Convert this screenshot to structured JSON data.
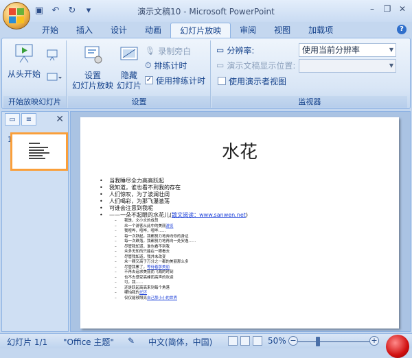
{
  "window": {
    "title": "演示文稿10 - Microsoft PowerPoint",
    "controls": [
      "–",
      "❐",
      "✕"
    ]
  },
  "quick_access": [
    {
      "name": "save-icon",
      "glyph": "💾"
    },
    {
      "name": "undo-icon",
      "glyph": "↶"
    },
    {
      "name": "redo-icon",
      "glyph": "↻"
    },
    {
      "name": "customize-icon",
      "glyph": "▾"
    }
  ],
  "tabs": [
    {
      "id": "home",
      "label": "开始"
    },
    {
      "id": "insert",
      "label": "插入"
    },
    {
      "id": "design",
      "label": "设计"
    },
    {
      "id": "animations",
      "label": "动画"
    },
    {
      "id": "slideshow",
      "label": "幻灯片放映",
      "active": true
    },
    {
      "id": "review",
      "label": "审阅"
    },
    {
      "id": "view",
      "label": "视图"
    },
    {
      "id": "addins",
      "label": "加载项"
    }
  ],
  "ribbon": {
    "group1": {
      "label": "开始放映幻灯片",
      "from_start": "从头开始"
    },
    "group2": {
      "label": "设置",
      "setup_show_line1": "设置",
      "setup_show_line2": "幻灯片放映",
      "hide_slide_line1": "隐藏",
      "hide_slide_line2": "幻灯片",
      "record_narration": "录制旁白",
      "rehearse_timings": "排练计时",
      "use_rehearsed": "使用排练计时",
      "use_rehearsed_checked": true
    },
    "group3": {
      "label": "监视器",
      "resolution_label": "分辨率:",
      "resolution_value": "使用当前分辨率",
      "show_on_label": "演示文稿显示位置:",
      "show_on_value": "",
      "presenter_view": "使用演示者视图",
      "presenter_view_checked": false
    }
  },
  "left_pane": {
    "slide_number": "1",
    "close_glyph": "✕"
  },
  "slide": {
    "title": "水花",
    "bullets": [
      {
        "text": "当我睡尽全力高高跃起"
      },
      {
        "text": "我知道，谁也看不到我的存在"
      },
      {
        "text": "人们惊叹，为了波澜壮阔"
      },
      {
        "text": "人们喝彩，为那飞瀑激荡"
      },
      {
        "text": "可谁会注意到我呢"
      },
      {
        "text": "——一朵不起眼的水花儿(",
        "link": "散文阅读：www.sanwen.net",
        "tail": ")"
      }
    ],
    "subbullets": [
      {
        "text": "我是，文小文的成员"
      },
      {
        "text": "众一个游客从此中的美丽",
        "link": "游览"
      },
      {
        "text": "我喧哗，喧哗，喧哗……"
      },
      {
        "text": "每一次跃起，我都努力地奔向你的身边"
      },
      {
        "text": "每一次跌落，我都努力地再向一处安逸……"
      },
      {
        "text": "尽管我知道，谁也看不到我"
      },
      {
        "text": "众多无知的只能在一眼看去"
      },
      {
        "text": "尽管我知道，我并未改变"
      },
      {
        "text": "众一颗又高于万分之一都的美丽那么多"
      },
      {
        "text": "尽管我累了，",
        "link": "等待着那美丽"
      },
      {
        "text": "不再去追求美丽而飞溅的时刻"
      },
      {
        "text": "也不去感受高峰而高声的欢迎"
      },
      {
        "text": "可，我……"
      },
      {
        "text": "还是跃起高高来到每个角落"
      },
      {
        "text": "哪怕我的",
        "link": "光环"
      },
      {
        "text": "仅仅能够照亮",
        "link": "自己那小小的世界"
      }
    ]
  },
  "statusbar": {
    "slide_info": "幻灯片 1/1",
    "theme": "\"Office 主题\"",
    "language": "中文(简体，中国)",
    "zoom": "50%",
    "zoom_fraction": 0.5
  }
}
